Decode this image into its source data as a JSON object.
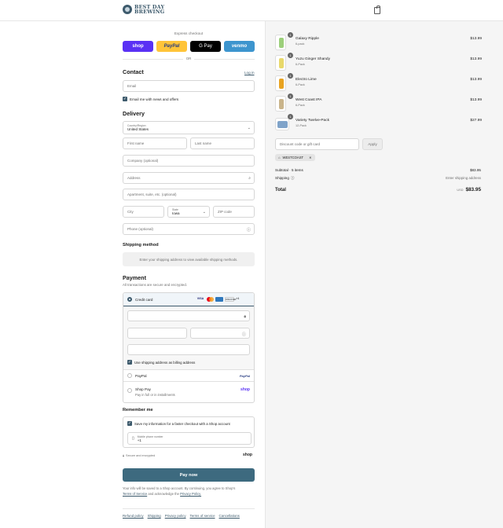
{
  "brand": {
    "name_line1": "BEST DAY",
    "name_line2": "BREWING"
  },
  "express": {
    "title": "Express checkout",
    "shop": "shop",
    "paypal": "PayPal",
    "gpay": "G Pay",
    "venmo": "venmo",
    "or": "OR"
  },
  "contact": {
    "title": "Contact",
    "login": "Log in",
    "email_placeholder": "Email",
    "news_label": "Email me with news and offers"
  },
  "delivery": {
    "title": "Delivery",
    "country_label": "Country/Region",
    "country_value": "United States",
    "first_name": "First name",
    "last_name": "Last name",
    "company": "Company (optional)",
    "address": "Address",
    "apartment": "Apartment, suite, etc. (optional)",
    "city": "City",
    "state_label": "State",
    "state_value": "Iowa",
    "zip": "ZIP code",
    "phone": "Phone (optional)"
  },
  "shipping": {
    "title": "Shipping method",
    "note": "Enter your shipping address to view available shipping methods."
  },
  "payment": {
    "title": "Payment",
    "subtitle": "All transactions are secure and encrypted.",
    "credit_card": "Credit card",
    "card_brands": [
      "VISA",
      "MC",
      "AMEX",
      "DISCOVER"
    ],
    "more_cards": "+4",
    "billing_label": "Use shipping address as billing address",
    "paypal": "PayPal",
    "paypal_logo": "PayPal",
    "shoppay": "Shop Pay",
    "shoppay_sub": "Pay in full or in installments",
    "shoppay_logo": "shop"
  },
  "remember": {
    "title": "Remember me",
    "save_label": "Save my information for a faster checkout with a Shop account",
    "phone_label": "Mobile phone number",
    "phone_value": "+1",
    "secure": "Secure and encrypted",
    "shop_logo": "shop"
  },
  "pay_button": "Pay now",
  "legal": {
    "text": "Your info will be saved to a Shop account. By continuing, you agree to Shop's",
    "terms": "Terms of Service",
    "and": "and acknowledge the",
    "privacy": "Privacy Policy."
  },
  "footer": {
    "links": [
      "Refund policy",
      "Shipping",
      "Privacy policy",
      "Terms of service",
      "Cancellations"
    ]
  },
  "cart": {
    "items": [
      {
        "qty": "1",
        "name": "Galaxy Ripple",
        "variant": "6-pack",
        "price": "$13.99",
        "color": "#9ccf7a"
      },
      {
        "qty": "1",
        "name": "Yuzu Ginger Shandy",
        "variant": "6-Pack",
        "price": "$13.99",
        "color": "#e8d86a"
      },
      {
        "qty": "1",
        "name": "Electro Lime",
        "variant": "6-Pack",
        "price": "$13.99",
        "color": "#e8a320"
      },
      {
        "qty": "1",
        "name": "West Coast IPA",
        "variant": "6-Pack",
        "price": "$13.99",
        "color": "#c9b48a"
      },
      {
        "qty": "1",
        "name": "Variety Twelve-Pack",
        "variant": "12-Pack",
        "price": "$27.99",
        "color": "#7fa3c9"
      }
    ],
    "discount_placeholder": "Discount code or gift card",
    "apply": "Apply",
    "code": "WESTCOAST",
    "subtotal_label": "Subtotal · 5 items",
    "subtotal_value": "$83.95",
    "shipping_label": "Shipping",
    "shipping_value": "Enter shipping address",
    "total_label": "Total",
    "currency": "USD",
    "total_value": "$83.95"
  },
  "colors": {
    "accent": "#3d5a6c",
    "shop": "#5a31f4",
    "paypal": "#ffc439",
    "venmo": "#3d95ce"
  }
}
